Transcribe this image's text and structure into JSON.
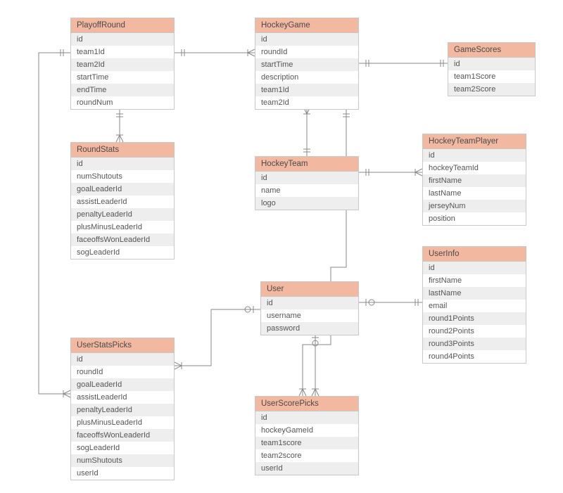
{
  "entities": {
    "playoffRound": {
      "title": "PlayoffRound",
      "fields": [
        "id",
        "team1Id",
        "team2Id",
        "startTime",
        "endTime",
        "roundNum"
      ]
    },
    "hockeyGame": {
      "title": "HockeyGame",
      "fields": [
        "id",
        "roundId",
        "startTime",
        "description",
        "team1Id",
        "team2Id"
      ]
    },
    "gameScores": {
      "title": "GameScores",
      "fields": [
        "id",
        "team1Score",
        "team2Score"
      ]
    },
    "roundStats": {
      "title": "RoundStats",
      "fields": [
        "id",
        "numShutouts",
        "goalLeaderId",
        "assistLeaderId",
        "penaltyLeaderId",
        "plusMinusLeaderId",
        "faceoffsWonLeaderId",
        "sogLeaderId"
      ]
    },
    "hockeyTeam": {
      "title": "HockeyTeam",
      "fields": [
        "id",
        "name",
        "logo"
      ]
    },
    "hockeyTeamPlayer": {
      "title": "HockeyTeamPlayer",
      "fields": [
        "id",
        "hockeyTeamId",
        "firstName",
        "lastName",
        "jerseyNum",
        "position"
      ]
    },
    "userInfo": {
      "title": "UserInfo",
      "fields": [
        "id",
        "firstName",
        "lastName",
        "email",
        "round1Points",
        "round2Points",
        "round3Points",
        "round4Points"
      ]
    },
    "user": {
      "title": "User",
      "fields": [
        "id",
        "username",
        "password"
      ]
    },
    "userStatsPicks": {
      "title": "UserStatsPicks",
      "fields": [
        "id",
        "roundId",
        "goalLeaderId",
        "assistLeaderId",
        "penaltyLeaderId",
        "plusMinusLeaderId",
        "faceoffsWonLeaderId",
        "sogLeaderId",
        "numShutouts",
        "userId"
      ]
    },
    "userScorePicks": {
      "title": "UserScorePicks",
      "fields": [
        "id",
        "hockeyGameId",
        "team1score",
        "team2score",
        "userId"
      ]
    }
  },
  "relationships": [
    {
      "from": "PlayoffRound",
      "to": "HockeyGame"
    },
    {
      "from": "PlayoffRound",
      "to": "RoundStats"
    },
    {
      "from": "HockeyGame",
      "to": "GameScores"
    },
    {
      "from": "HockeyGame",
      "to": "HockeyTeam"
    },
    {
      "from": "HockeyTeam",
      "to": "HockeyTeamPlayer"
    },
    {
      "from": "HockeyGame",
      "to": "UserScorePicks"
    },
    {
      "from": "User",
      "to": "UserInfo"
    },
    {
      "from": "User",
      "to": "UserScorePicks"
    },
    {
      "from": "User",
      "to": "UserStatsPicks"
    },
    {
      "from": "PlayoffRound",
      "to": "UserStatsPicks"
    }
  ],
  "chart_data": {
    "type": "er-diagram",
    "entities": [
      {
        "name": "PlayoffRound",
        "attributes": [
          "id",
          "team1Id",
          "team2Id",
          "startTime",
          "endTime",
          "roundNum"
        ]
      },
      {
        "name": "HockeyGame",
        "attributes": [
          "id",
          "roundId",
          "startTime",
          "description",
          "team1Id",
          "team2Id"
        ]
      },
      {
        "name": "GameScores",
        "attributes": [
          "id",
          "team1Score",
          "team2Score"
        ]
      },
      {
        "name": "RoundStats",
        "attributes": [
          "id",
          "numShutouts",
          "goalLeaderId",
          "assistLeaderId",
          "penaltyLeaderId",
          "plusMinusLeaderId",
          "faceoffsWonLeaderId",
          "sogLeaderId"
        ]
      },
      {
        "name": "HockeyTeam",
        "attributes": [
          "id",
          "name",
          "logo"
        ]
      },
      {
        "name": "HockeyTeamPlayer",
        "attributes": [
          "id",
          "hockeyTeamId",
          "firstName",
          "lastName",
          "jerseyNum",
          "position"
        ]
      },
      {
        "name": "UserInfo",
        "attributes": [
          "id",
          "firstName",
          "lastName",
          "email",
          "round1Points",
          "round2Points",
          "round3Points",
          "round4Points"
        ]
      },
      {
        "name": "User",
        "attributes": [
          "id",
          "username",
          "password"
        ]
      },
      {
        "name": "UserStatsPicks",
        "attributes": [
          "id",
          "roundId",
          "goalLeaderId",
          "assistLeaderId",
          "penaltyLeaderId",
          "plusMinusLeaderId",
          "faceoffsWonLeaderId",
          "sogLeaderId",
          "numShutouts",
          "userId"
        ]
      },
      {
        "name": "UserScorePicks",
        "attributes": [
          "id",
          "hockeyGameId",
          "team1score",
          "team2score",
          "userId"
        ]
      }
    ],
    "relationships": [
      {
        "from": "PlayoffRound",
        "to": "HockeyGame",
        "type": "one-to-many"
      },
      {
        "from": "PlayoffRound",
        "to": "RoundStats",
        "type": "one-to-many"
      },
      {
        "from": "HockeyGame",
        "to": "GameScores",
        "type": "one-to-one"
      },
      {
        "from": "HockeyGame",
        "to": "HockeyTeam",
        "type": "many-to-one"
      },
      {
        "from": "HockeyTeam",
        "to": "HockeyTeamPlayer",
        "type": "one-to-many"
      },
      {
        "from": "HockeyGame",
        "to": "UserScorePicks",
        "type": "one-to-many"
      },
      {
        "from": "User",
        "to": "UserInfo",
        "type": "one-to-one"
      },
      {
        "from": "User",
        "to": "UserScorePicks",
        "type": "one-to-many"
      },
      {
        "from": "User",
        "to": "UserStatsPicks",
        "type": "one-to-many"
      },
      {
        "from": "PlayoffRound",
        "to": "UserStatsPicks",
        "type": "one-to-many"
      }
    ]
  }
}
